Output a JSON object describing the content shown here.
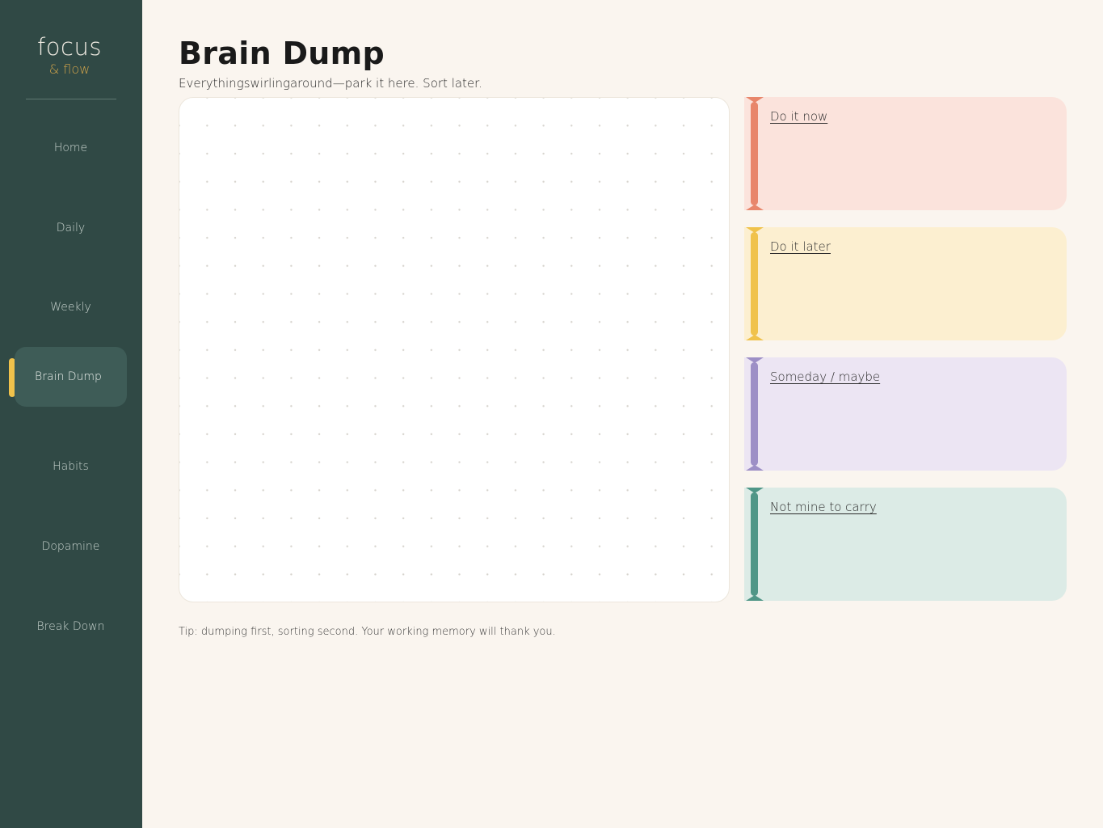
{
  "sidebar": {
    "brand": {
      "name": "focus",
      "sub": "& flow"
    },
    "items": [
      {
        "label": "Home"
      },
      {
        "label": "Daily"
      },
      {
        "label": "Weekly"
      },
      {
        "label": "Brain Dump",
        "active": true
      },
      {
        "label": "Habits"
      },
      {
        "label": "Dopamine"
      },
      {
        "label": "Break Down"
      }
    ]
  },
  "page": {
    "title": "Brain Dump",
    "subtitle": "Everythingswirlingaround—park it here. Sort later."
  },
  "buckets": [
    {
      "label": "Do it now",
      "bg": "#fbe3dc",
      "accent": "#e8866b"
    },
    {
      "label": "Do it later",
      "bg": "#fcefd0",
      "accent": "#f0c24b"
    },
    {
      "label": "Someday / maybe",
      "bg": "#ece5f3",
      "accent": "#9d8fc6"
    },
    {
      "label": "Not mine to carry",
      "bg": "#dcebe6",
      "accent": "#4f9687"
    }
  ],
  "tip": "Tip: dumping first, sorting second. Your working memory will thank you.",
  "colors": {
    "sidebar_bg": "#304945",
    "active_item_bg": "#3e5c57",
    "active_marker": "#f0c24b",
    "brand_sub": "#d2a44a",
    "page_bg": "#faf5ef"
  }
}
